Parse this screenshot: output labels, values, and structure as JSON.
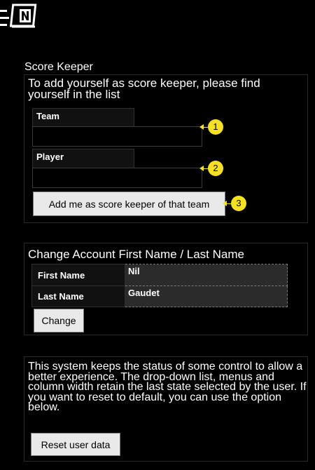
{
  "header": {
    "menu_icon": "menu-icon",
    "logo_icon": "app-logo-icon"
  },
  "score_keeper": {
    "title": "Score Keeper",
    "description": "To add yourself as score keeper, please find yourself in the list",
    "team": {
      "label": "Team",
      "value": "",
      "badge": "1"
    },
    "player": {
      "label": "Player",
      "value": "",
      "badge": "2"
    },
    "add_button": {
      "label": "Add me as score keeper of that team",
      "badge": "3"
    }
  },
  "account": {
    "title": "Change Account First Name / Last Name",
    "first_name": {
      "label": "First Name",
      "value": "Nil"
    },
    "last_name": {
      "label": "Last Name",
      "value": "Gaudet"
    },
    "change_button": "Change"
  },
  "reset": {
    "description": "This system keeps the status of some control to allow a better experience. The drop-down list, menus and column width retain the last state selected by the user. If you want to reset to default, you can use the option below.",
    "button": "Reset user data"
  },
  "colors": {
    "background": "#000000",
    "badge": "#f6e024",
    "button": "#e9e9e9"
  }
}
